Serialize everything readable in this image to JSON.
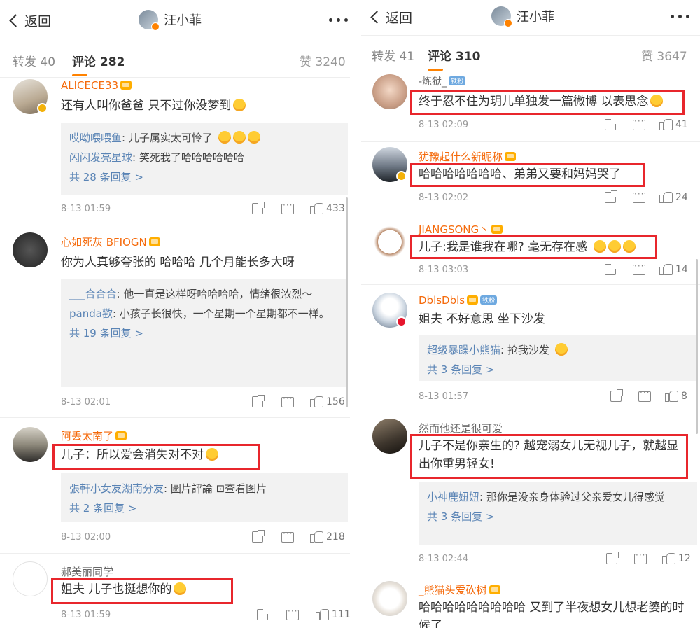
{
  "left": {
    "back_label": "返回",
    "title": "汪小菲",
    "tabs": {
      "repost": "转发 40",
      "comments_label": "评论",
      "comments_count": "282",
      "likes": "赞 3240"
    },
    "comments": [
      {
        "name": "ALICECE33",
        "text": "还有人叫你爸爸 只不过你没梦到",
        "replies": [
          {
            "name": "哎呦喂喂鱼",
            "text": ": 儿子属实太可怜了"
          },
          {
            "name": "闪闪发亮星球",
            "text": ": 笑死我了哈哈哈哈哈哈"
          }
        ],
        "replies_more": "共 28 条回复 >",
        "time": "8-13 01:59",
        "likes": "433"
      },
      {
        "name": "心如死灰 BFIOGN",
        "text": "你为人真够夸张的 哈哈哈 几个月能长多大呀",
        "replies": [
          {
            "name": "___合合合",
            "text": ": 他一直是这样呀哈哈哈哈，情绪很浓烈～"
          },
          {
            "name": "panda歡",
            "text": ": 小孩子长很快，一个星期一个星期都不一样。"
          }
        ],
        "replies_more": "共 19 条回复 >",
        "time": "8-13 02:01",
        "likes": "156"
      },
      {
        "name": "阿丢太南了",
        "text": "儿子：所以爱会消失对不对",
        "replies": [
          {
            "name": "張軒小女友湖南分友",
            "text": ": 圖片評論 ⊡查看图片"
          }
        ],
        "replies_more": "共 2 条回复 >",
        "time": "8-13 02:00",
        "likes": "218"
      },
      {
        "name": "郝美丽同学",
        "text": "姐夫 儿子也挺想你的",
        "time": "8-13 01:59",
        "likes": "111"
      }
    ]
  },
  "right": {
    "back_label": "返回",
    "title": "汪小菲",
    "tabs": {
      "repost": "转发 41",
      "comments_label": "评论",
      "comments_count": "310",
      "likes": "赞 3647"
    },
    "comments": [
      {
        "name": "-炼狱_",
        "badge": "铁粉",
        "text": "终于忍不住为玥儿单独发一篇微博 以表思念",
        "time": "8-13 02:09",
        "likes": "41"
      },
      {
        "name": "犹豫起什么新昵称",
        "text": "哈哈哈哈哈哈哈、弟弟又要和妈妈哭了",
        "time": "8-13 02:02",
        "likes": "24"
      },
      {
        "name": "JIANGSONG丶",
        "text": "儿子:我是谁我在哪? 毫无存在感",
        "time": "8-13 03:03",
        "likes": "14"
      },
      {
        "name": "DblsDbls",
        "badge": "铁粉",
        "text": "姐夫 不好意思 坐下沙发",
        "replies": [
          {
            "name": "超级暴躁小熊猫",
            "text": ": 抢我沙发"
          }
        ],
        "replies_more": "共 3 条回复 >",
        "time": "8-13 01:57",
        "likes": "8"
      },
      {
        "name": "然而他还是很可爱",
        "text": "儿子不是你亲生的? 越宠溺女儿无视儿子，就越显出你重男轻女!",
        "replies": [
          {
            "name": "小神鹿妞妞",
            "text": ": 那你是没亲身体验过父亲爱女儿得感觉"
          }
        ],
        "replies_more": "共 3 条回复 >",
        "time": "8-13 02:44",
        "likes": "12"
      },
      {
        "name": "_熊猫头爱砍树",
        "text": "哈哈哈哈哈哈哈哈哈 又到了半夜想女儿想老婆的时候了"
      }
    ]
  },
  "colors": {
    "accent": "#ff8200",
    "highlight_box": "#e8262c",
    "reply_name": "#5a84b5",
    "vip_name": "#f56a0b"
  }
}
